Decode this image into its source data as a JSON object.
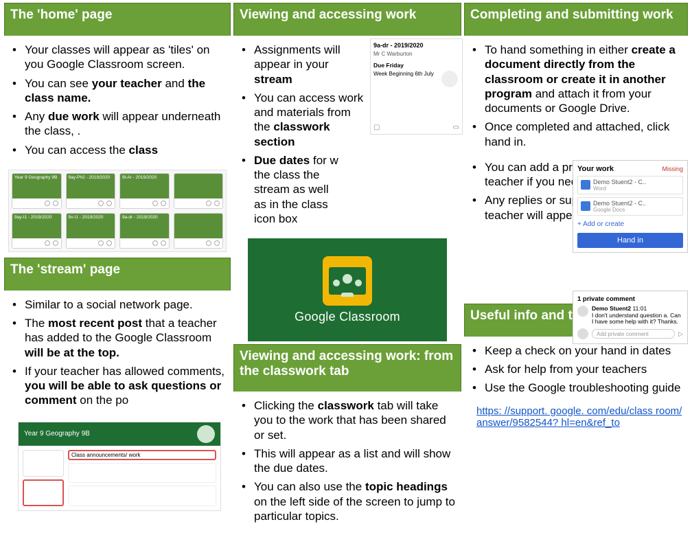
{
  "columns": {
    "home": {
      "title": "The 'home' page",
      "points_html": [
        "Your classes will appear as 'tiles' on you Google Classroom screen.",
        "You can see <b>your teacher</b> and <b>the class name.</b>",
        "Any <b>due work</b> will appear underneath the class, .",
        "You can access the <b>class</b>"
      ],
      "tile_labels": [
        "Year 9 Geography 9B",
        "9ay-Ph2 - 2019/2020",
        "9l-Ar - 2019/2020",
        "",
        "9ay-I1 - 2019/2020",
        "9x-I1 - 2019/2020",
        "9a-dr - 2019/2020",
        ""
      ]
    },
    "stream": {
      "title": "The 'stream' page",
      "points_html": [
        "Similar to a social network page.",
        "The <b>most recent post</b> that a teacher has added to the Google Classroom <b>will be at the top.</b>",
        "If your teacher has allowed comments, <b>you will be able to ask questions or comment</b> on the po"
      ],
      "mock": {
        "banner": "Year 9 Geography 9B",
        "announcement": "Class announcements/ work"
      }
    },
    "view": {
      "title": "Viewing and accessing work",
      "points_html": [
        "Assignments will appear in your <b>stream</b>",
        "You can access work and materials from the <b>classwork section</b>",
        "<b>Due dates</b> for w<br>the class the<br>stream as well<br>as in the class<br>icon box"
      ],
      "assign": {
        "class": "9a-dr - 2019/2020",
        "teacher": "Mr C Warburton",
        "due": "Due Friday",
        "line": "Week Beginning 6th July"
      },
      "badge": "Google Classroom"
    },
    "classwork": {
      "title": "Viewing and accessing work: from the classwork tab",
      "points_html": [
        "Clicking the <b>classwork</b> tab will take you to the work that has been shared or set.",
        "This will appear as a list and will show the due dates.",
        "You can also use the <b>topic headings</b> on the left side of the screen to jump to particular topics."
      ]
    },
    "submit": {
      "title": "Completing and submitting work",
      "top_points_html": [
        "To hand something in either <b>create a document directly from the classroom or create it in another program</b> and attach it from your documents or Google Drive.",
        "Once completed and attached, click hand in."
      ],
      "wrapped_points_html": [
        "You can add a private comment to the teacher if you need help.",
        "Any replies or support from your teacher will appear here."
      ],
      "work_panel": {
        "title": "Your work",
        "status": "Missing",
        "file1": "Demo Stuent2 - C..",
        "file1_sub": "Word",
        "file2": "Demo Stuent2 - C..",
        "file2_sub": "Google Docs",
        "add": "+ Add or create",
        "handin": "Hand in"
      },
      "pc_panel": {
        "header": "1 private comment",
        "name": "Demo Stuent2",
        "time": "11:01",
        "msg": "I don't understand question a. Can I have some help with it? Thanks.",
        "placeholder": "Add private comment"
      }
    },
    "tips": {
      "title": "Useful info and tips",
      "points_html": [
        "Keep a check on your hand in dates",
        "Ask for help from your teachers",
        "Use the Google troubleshooting guide"
      ],
      "link_text": "https: //support. google. com/edu/class room/answer/9582544? hl=en&ref_to"
    }
  }
}
